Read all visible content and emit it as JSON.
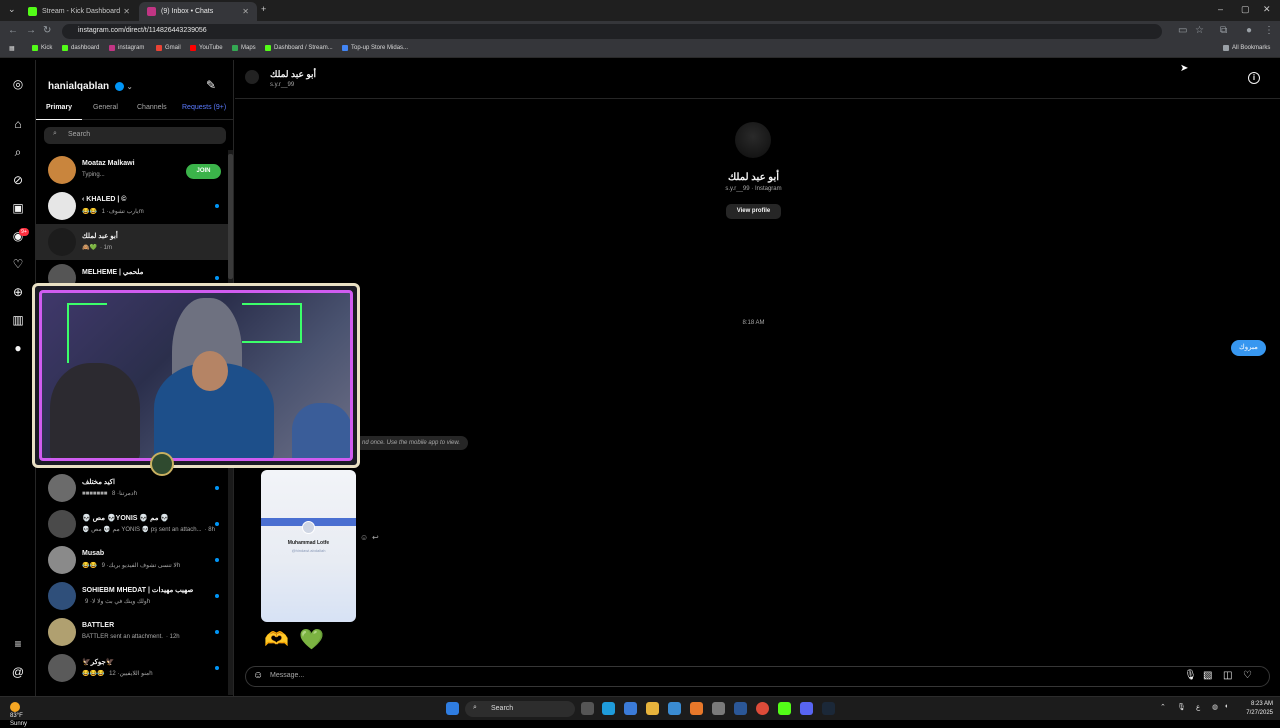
{
  "browser": {
    "tabs": [
      {
        "title": "Stream - Kick Dashboard",
        "color": "#53fc18"
      },
      {
        "title": "(9) Inbox • Chats",
        "color": "#c13584"
      }
    ],
    "url": "instagram.com/direct/t/114826443239056",
    "bookmarks": [
      {
        "label": "Kick",
        "color": "#53fc18"
      },
      {
        "label": "dashboard",
        "color": "#53fc18"
      },
      {
        "label": "instagram",
        "color": "#c13584"
      },
      {
        "label": "Gmail",
        "color": "#ea4335"
      },
      {
        "label": "YouTube",
        "color": "#ff0000"
      },
      {
        "label": "Maps",
        "color": "#34a853"
      },
      {
        "label": "Dashboard / Stream...",
        "color": "#53fc18"
      },
      {
        "label": "Top-up Store Midas...",
        "color": "#4285f4"
      }
    ],
    "all_bookmarks": "All Bookmarks"
  },
  "rail": {
    "messages_badge": "9+",
    "icons": [
      "instagram-logo-icon",
      "home-icon",
      "search-icon",
      "explore-icon",
      "reels-icon",
      "messages-icon",
      "notifications-icon",
      "create-icon",
      "dashboard-icon",
      "profile-icon",
      "menu-icon",
      "threads-icon"
    ]
  },
  "inbox": {
    "username": "hanialqablan",
    "tabs": [
      "Primary",
      "General",
      "Channels",
      "Requests (9+)"
    ],
    "search_placeholder": "Search",
    "join_label": "JOIN",
    "chats": [
      {
        "name": "Moataz Malkawi",
        "preview": "Typing...",
        "time": "",
        "unread": false,
        "selected": false,
        "avatar": "#c9853d",
        "join": true
      },
      {
        "name": "‹ KHALED | ©",
        "preview": "😂😂 يارب تشوف",
        "time": "· 1m",
        "unread": true,
        "selected": false,
        "avatar": "#e6e6e6",
        "join": false
      },
      {
        "name": "أبو عبد لملك",
        "preview": "🙈💚",
        "time": "· 1m",
        "unread": false,
        "selected": true,
        "avatar": "#1c1c1c",
        "join": false
      },
      {
        "name": "MELHEME | ملحمي",
        "preview": "",
        "time": "",
        "unread": true,
        "selected": false,
        "avatar": "#555555",
        "join": false
      },
      {
        "name": "اكيد مختلف",
        "preview": "■■■■■■■ دمرتنا",
        "time": "· 8h",
        "unread": true,
        "selected": false,
        "avatar": "#6b6b6b",
        "join": false
      },
      {
        "name": "💀 مص 💀YONIS 💀 مم 💀",
        "preview": "💀 مم 💀 مص YONIS 💀 pş sent an attach...",
        "time": "· 8h",
        "unread": true,
        "selected": false,
        "avatar": "#4a4a4a",
        "join": false
      },
      {
        "name": "Musab",
        "preview": "😂😂 لا تنسى تشوف الفيديو بريك",
        "time": "· 9h",
        "unread": true,
        "selected": false,
        "avatar": "#8a8a8a",
        "join": false
      },
      {
        "name": "SOHIEBM MHEDAT | صهيب مهيدات",
        "preview": "ولك وينك في بث ولا لا",
        "time": "· 9h",
        "unread": true,
        "selected": false,
        "avatar": "#2f4f7a",
        "join": false
      },
      {
        "name": "BATTLER",
        "preview": "BATTLER sent an attachment.",
        "time": "· 12h",
        "unread": true,
        "selected": false,
        "avatar": "#b0a070",
        "join": false
      },
      {
        "name": "🦅جوكر🦅",
        "preview": "😂😂😂 منو اللايفيين",
        "time": "· 12h",
        "unread": true,
        "selected": false,
        "avatar": "#5a5a5a",
        "join": false
      }
    ]
  },
  "chat": {
    "name": "أبو عبد لملك",
    "handle": "s.y.r__99",
    "profile_sub": "s.y.r__99 · Instagram",
    "view_profile": "View profile",
    "timestamp": "8:18 AM",
    "my_message": "مبروك",
    "view_once_note": "nd once. Use the mobile app to view.",
    "card_name": "Muhammad Lotfe",
    "card_sub": "@hindawi.abdallah",
    "stickers": [
      "🫶",
      "💚"
    ],
    "composer_placeholder": "Message..."
  },
  "taskbar": {
    "weather_temp": "83°F",
    "weather_desc": "Sunny",
    "search_label": "Search",
    "lang": "ع",
    "time": "8:23 AM",
    "date": "7/27/2025"
  }
}
